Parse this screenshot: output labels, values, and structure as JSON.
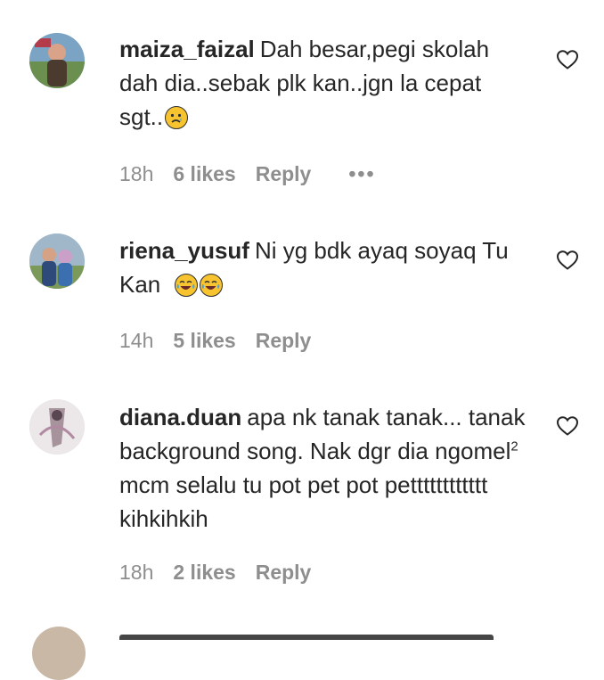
{
  "comments": [
    {
      "username": "maiza_faizal",
      "text": "Dah besar,pegi skolah dah dia..sebak plk kan..jgn la cepat sgt..",
      "time": "18h",
      "likes": "6 likes",
      "reply": "Reply",
      "more": "•••",
      "emoji": [
        "crying-face"
      ]
    },
    {
      "username": "riena_yusuf",
      "text": "Ni yg bdk ayaq soyaq Tu Kan",
      "time": "14h",
      "likes": "5 likes",
      "reply": "Reply",
      "emoji": [
        "tears-of-joy-face",
        "tears-of-joy-face"
      ]
    },
    {
      "username": "diana.duan",
      "text_before_sup": "apa nk tanak tanak... tanak background song. Nak dgr dia ngomel",
      "superscript": "2",
      "text_after_sup": " mcm selalu tu pot pet pot petttttttttttt kihkihkih",
      "time": "18h",
      "likes": "2 likes",
      "reply": "Reply"
    }
  ],
  "icons": {
    "like": "heart-outline-icon"
  },
  "colors": {
    "text": "#262626",
    "meta": "#8e8e8e",
    "background": "#ffffff"
  }
}
